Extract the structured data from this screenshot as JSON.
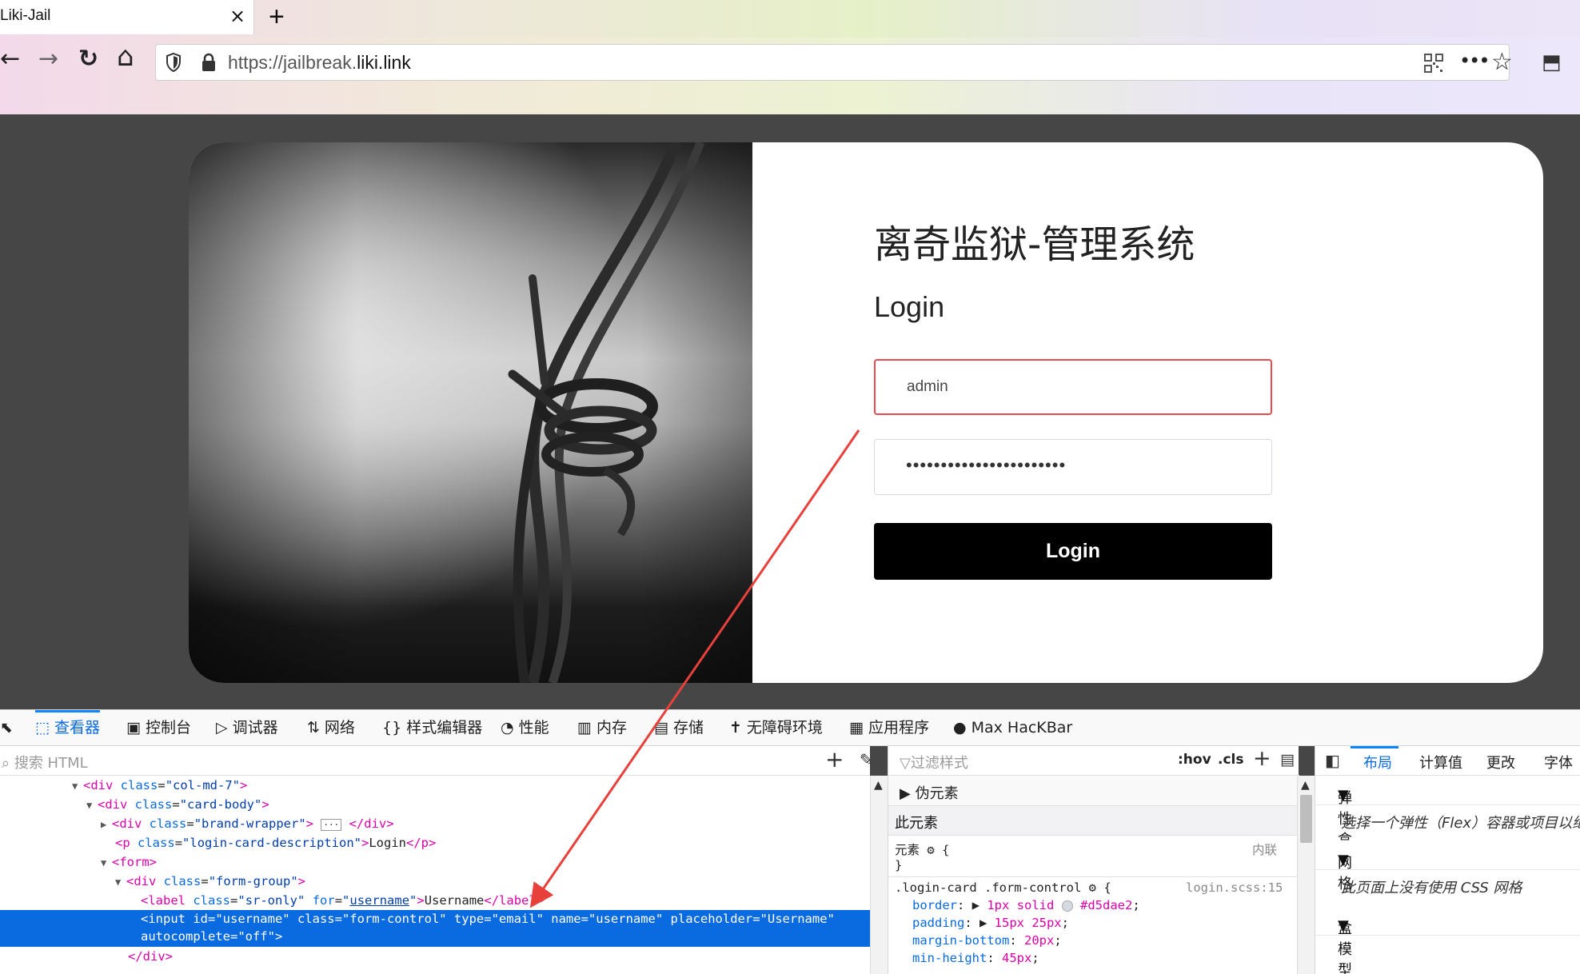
{
  "browser": {
    "tab_title": "Liki-Jail",
    "tab_close": "×",
    "new_tab": "+",
    "back": "←",
    "forward": "→",
    "reload": "↻",
    "home": "⌂",
    "url_prefix": "https://jailbreak.",
    "url_domain": "liki.link",
    "more": "•••",
    "bookmark": "☆",
    "extension": "⬒"
  },
  "page": {
    "brand_title": "离奇监狱-管理系统",
    "login_description": "Login",
    "username_value": "admin",
    "password_value": "•••••••••••••••••••••••",
    "login_button": "Login"
  },
  "devtools": {
    "tabs": [
      {
        "label": "查看器",
        "icon": "inspector-icon",
        "glyph": "⬚"
      },
      {
        "label": "控制台",
        "icon": "console-icon",
        "glyph": "▣"
      },
      {
        "label": "调试器",
        "icon": "debugger-icon",
        "glyph": "▷"
      },
      {
        "label": "网络",
        "icon": "network-icon",
        "glyph": "⇅"
      },
      {
        "label": "样式编辑器",
        "icon": "style-editor-icon",
        "glyph": "{}"
      },
      {
        "label": "性能",
        "icon": "performance-icon",
        "glyph": "◔"
      },
      {
        "label": "内存",
        "icon": "memory-icon",
        "glyph": "▥"
      },
      {
        "label": "存储",
        "icon": "storage-icon",
        "glyph": "▤"
      },
      {
        "label": "无障碍环境",
        "icon": "accessibility-icon",
        "glyph": "✝"
      },
      {
        "label": "应用程序",
        "icon": "application-icon",
        "glyph": "▦"
      },
      {
        "label": "Max HacKBar",
        "icon": "hackbar-icon",
        "glyph": "●"
      }
    ],
    "search_placeholder": "搜索 HTML",
    "filter_placeholder": "过滤样式",
    "hov": ":hov",
    "cls": ".cls",
    "pseudo_elements": "伪元素",
    "this_element": "此元素",
    "element_label": "元素",
    "inline_label": "内联",
    "rule_selector": ".login-card .form-control",
    "rule_source": "login.scss:15",
    "rule_props": [
      {
        "name": "border",
        "value": "1px solid",
        "color": "#d5dae2"
      },
      {
        "name": "padding",
        "value": "15px 25px"
      },
      {
        "name": "margin-bottom",
        "value": "20px"
      },
      {
        "name": "min-height",
        "value": "45px"
      }
    ],
    "layout_tabs": [
      "布局",
      "计算值",
      "更改",
      "字体"
    ],
    "flexbox_section": "弹性盒",
    "flexbox_note": "选择一个弹性（Flex）容器或项目以继续",
    "grid_section": "网格",
    "grid_note": "此页面上没有使用 CSS 网格",
    "box_model_section": "盒模型"
  },
  "accent_color": "#0a6be0",
  "arrow_color": "#e8403a"
}
